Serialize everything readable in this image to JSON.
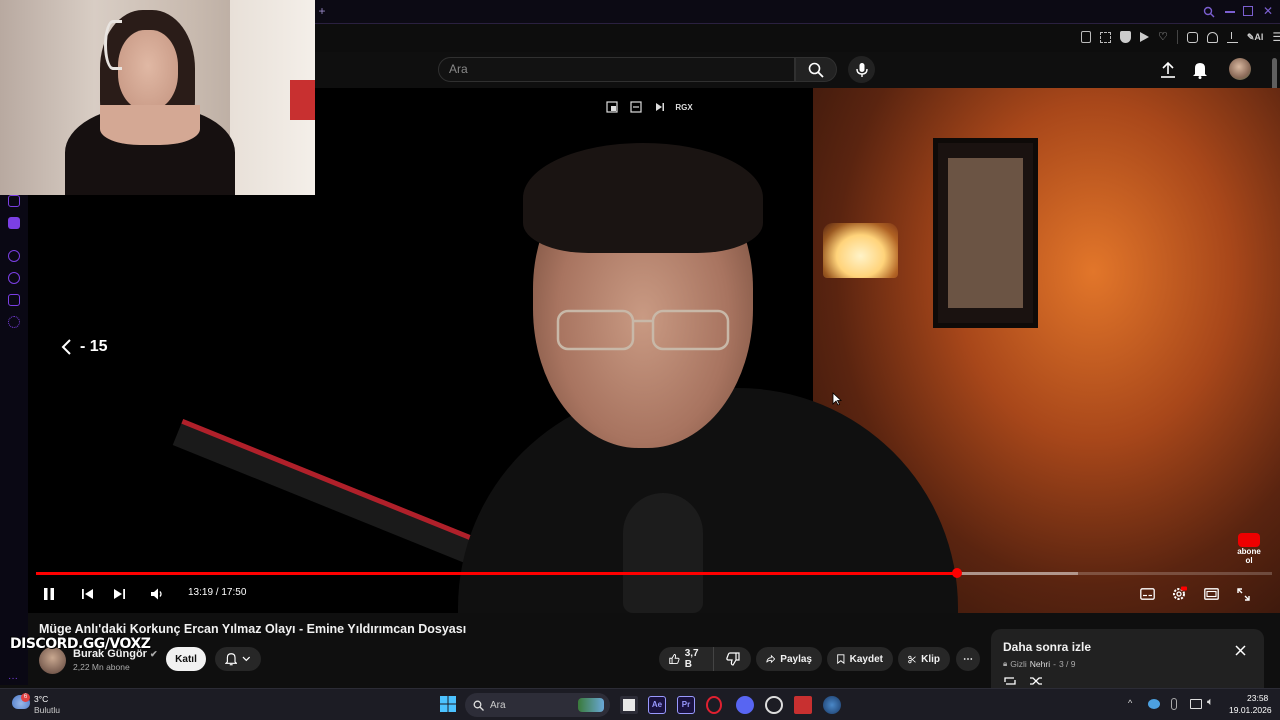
{
  "search": {
    "placeholder": "Ara"
  },
  "player": {
    "seek_hint": "- 15",
    "time": "13:19 / 17:50",
    "progress_fraction": 0.745,
    "buffer_fraction": 0.843,
    "abone_text": "abone ol",
    "rgx_label": "RGX"
  },
  "video": {
    "title": "Müge Anlı'daki Korkunç Ercan Yılmaz Olayı - Emine Yıldırımcan Dosyası",
    "channel": "Burak Güngör",
    "subscribers": "2,22 Mn abone",
    "join_label": "Katıl",
    "like_count": "3,7 B",
    "share_label": "Paylaş",
    "save_label": "Kaydet",
    "clip_label": "Klip"
  },
  "watermark": "DISCORD.GG/VOXZ",
  "watch_later": {
    "title": "Daha sonra izle",
    "privacy": "Gizli",
    "owner": "Nehri",
    "position": "3 / 9"
  },
  "taskbar": {
    "weather_temp": "3°C",
    "weather_desc": "Bulutlu",
    "search_label": "Ara",
    "time": "23:58",
    "date": "19.01.2026"
  },
  "colors": {
    "accent_red": "#ff0000",
    "background": "#0f0f0f",
    "browser_accent": "#7b3fe4"
  }
}
